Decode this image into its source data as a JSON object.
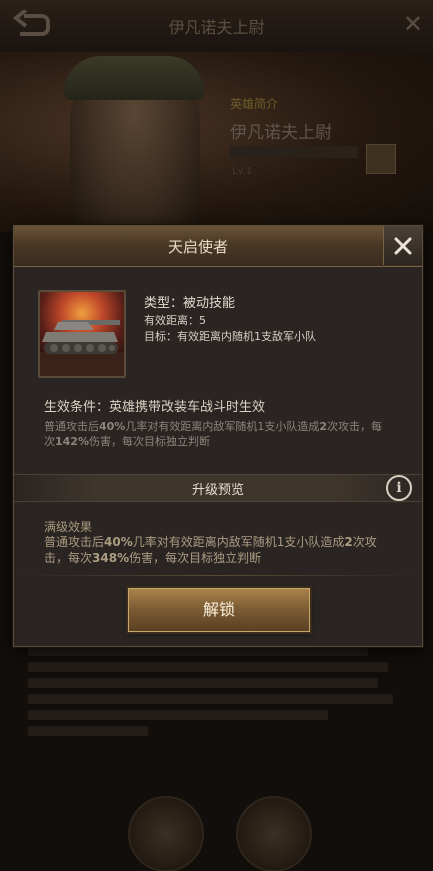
{
  "background": {
    "title": "伊凡诺夫上尉",
    "subtitle": "英雄简介",
    "hero_name": "伊凡诺夫上尉",
    "level": "Lv.1"
  },
  "dialog": {
    "title": "天启使者",
    "skill": {
      "type": "类型：被动技能",
      "range": "有效距离：5",
      "target": "目标：有效距离内随机1支敌军小队"
    },
    "condition": {
      "label": "生效条件：英雄携带改装车战斗时生效",
      "desc_a": "普通攻击后",
      "desc_pct": "40%",
      "desc_b": "几率对有效距离内敌军随机1支小队造成",
      "desc_times": "2",
      "desc_c": "次攻击，每次",
      "desc_dmg": "142%",
      "desc_d": "伤害，每次目标独立判断"
    },
    "upgrade_preview": "升级预览",
    "full_effect": {
      "label": "满级效果",
      "desc_a": "普通攻击后",
      "desc_pct": "40%",
      "desc_b": "几率对有效距离内敌军随机1支小队造成",
      "desc_times": "2",
      "desc_c": "次攻击，每次",
      "desc_dmg": "348%",
      "desc_d": "伤害，每次目标独立判断"
    },
    "unlock_label": "解锁"
  },
  "colors": {
    "accent_gold": "#a8824c",
    "text_highlight": "#e4ddd2",
    "text_dim": "#8c837a"
  }
}
